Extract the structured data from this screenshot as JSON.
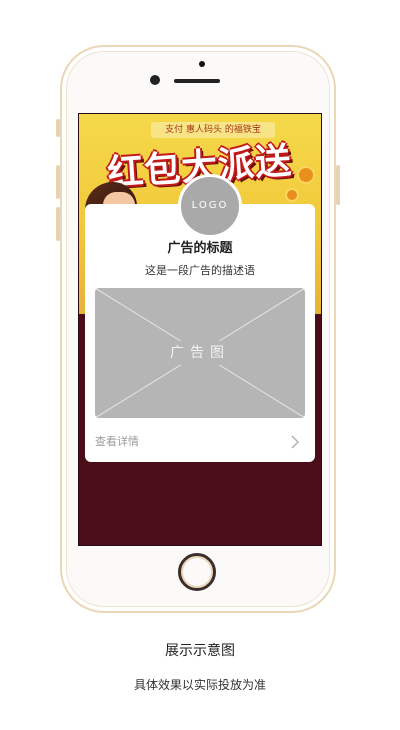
{
  "banner": {
    "top_text": "支付 惠人码头 的福铁宝",
    "title": "红包大派送"
  },
  "ad_card": {
    "logo_text": "LOGO",
    "title": "广告的标题",
    "description": "这是一段广告的描述语",
    "image_placeholder": "广告图",
    "detail_link": "查看详情",
    "chevron_icon": "chevron-right-icon"
  },
  "captions": {
    "main": "展示示意图",
    "sub": "具体效果以实际投放为准"
  },
  "colors": {
    "phone_frame": "#e9d7b8",
    "screen_bg": "#4b0d1a",
    "banner_yellow": "#f2c93b",
    "logo_gray": "#a9a9a9",
    "placeholder_gray": "#b5b5b5"
  }
}
